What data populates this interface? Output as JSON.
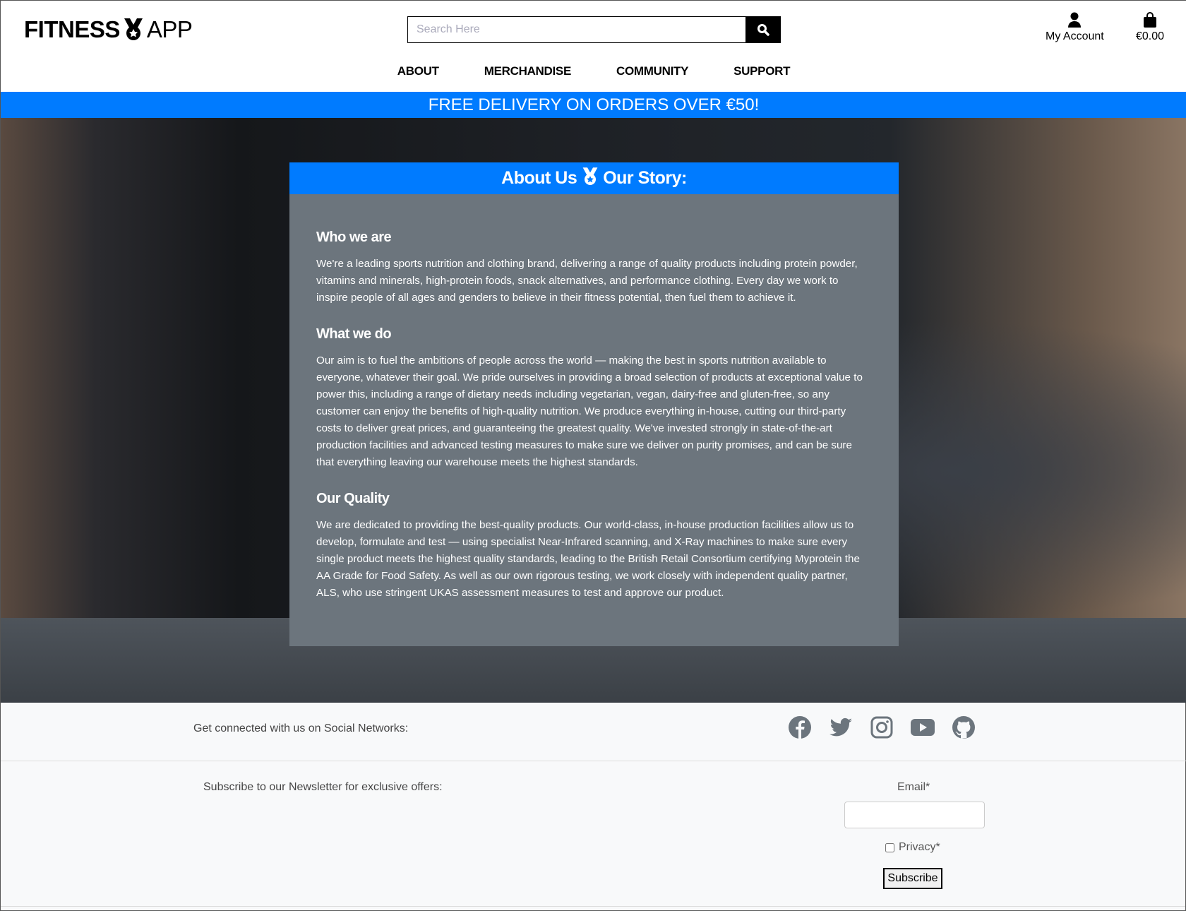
{
  "header": {
    "logo_left": "FITNESS",
    "logo_right": "APP",
    "search_placeholder": "Search Here",
    "account_label": "My Account",
    "cart_total": "€0.00"
  },
  "nav": [
    "ABOUT",
    "MERCHANDISE",
    "COMMUNITY",
    "SUPPORT"
  ],
  "banner": "FREE DELIVERY ON ORDERS OVER €50!",
  "card": {
    "title_left": "About Us",
    "title_right": "Our Story:",
    "sections": [
      {
        "heading": "Who we are",
        "text": "We're a leading sports nutrition and clothing brand, delivering a range of quality products including protein powder, vitamins and minerals, high-protein foods, snack alternatives, and performance clothing. Every day we work to inspire people of all ages and genders to believe in their fitness potential, then fuel them to achieve it."
      },
      {
        "heading": "What we do",
        "text": "Our aim is to fuel the ambitions of people across the world — making the best in sports nutrition available to everyone, whatever their goal. We pride ourselves in providing a broad selection of products at exceptional value to power this, including a range of dietary needs including vegetarian, vegan, dairy-free and gluten-free, so any customer can enjoy the benefits of high-quality nutrition. We produce everything in-house, cutting our third-party costs to deliver great prices, and guaranteeing the greatest quality. We've invested strongly in state-of-the-art production facilities and advanced testing measures to make sure we deliver on purity promises, and can be sure that everything leaving our warehouse meets the highest standards."
      },
      {
        "heading": "Our Quality",
        "text": "We are dedicated to providing the best-quality products. Our world-class, in-house production facilities allow us to develop, formulate and test — using specialist Near-Infrared scanning, and X-Ray machines to make sure every single product meets the highest quality standards, leading to the British Retail Consortium certifying Myprotein the AA Grade for Food Safety. As well as our own rigorous testing, we work closely with independent quality partner, ALS, who use stringent UKAS assessment measures to test and approve our product."
      }
    ]
  },
  "footer": {
    "social_label": "Get connected with us on Social Networks:",
    "social_icons": [
      "facebook-icon",
      "twitter-icon",
      "instagram-icon",
      "youtube-icon",
      "github-icon"
    ],
    "newsletter_label": "Subscribe to our Newsletter for exclusive offers:",
    "email_label": "Email*",
    "privacy_label": "Privacy*",
    "subscribe_label": "Subscribe"
  },
  "colors": {
    "accent": "#007bff",
    "card": "#6c757d",
    "icon": "#6c757d"
  }
}
